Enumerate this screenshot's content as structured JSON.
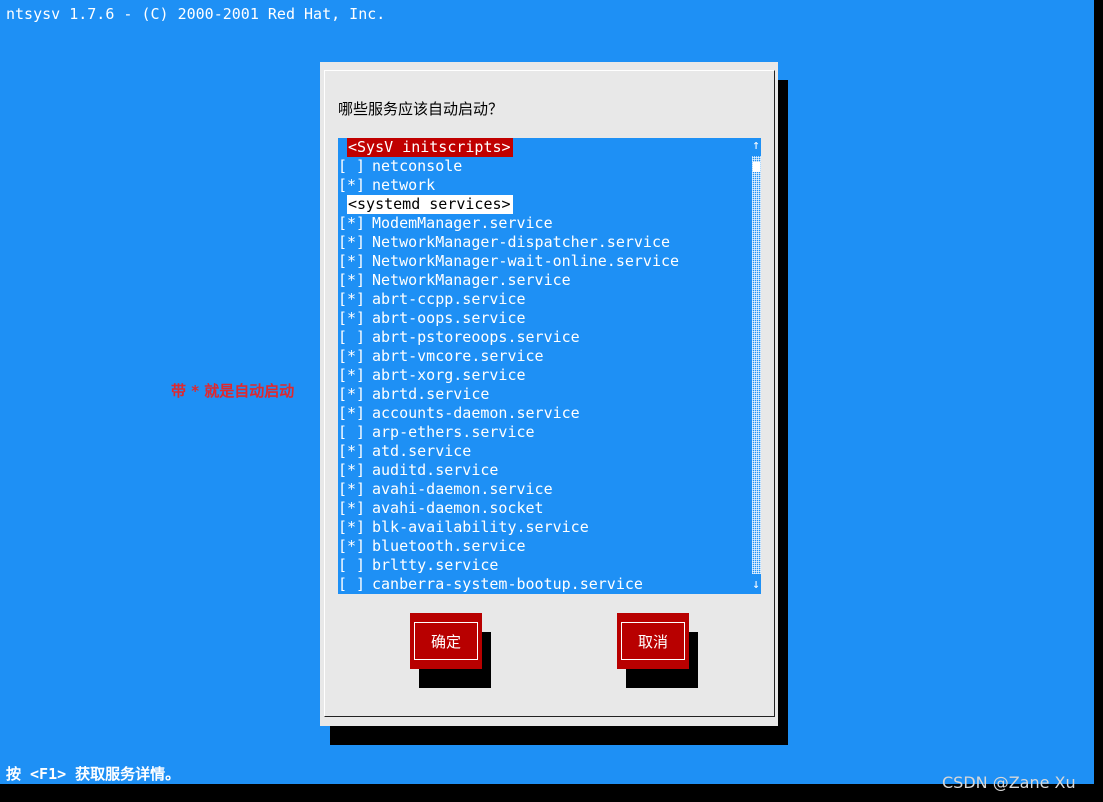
{
  "terminal": {
    "title": "ntsysv 1.7.6 - (C) 2000-2001 Red Hat, Inc.",
    "hint": "按 <F1> 获取服务详情。"
  },
  "annotation": "带 * 就是自动启动",
  "watermark": "CSDN @Zane Xu",
  "dialog": {
    "prompt": "哪些服务应该自动启动？",
    "items": [
      {
        "type": "header",
        "label": "<SysV initscripts>",
        "style": "selected"
      },
      {
        "type": "service",
        "mark": "[ ]",
        "name": "netconsole"
      },
      {
        "type": "service",
        "mark": "[*]",
        "name": "network"
      },
      {
        "type": "header",
        "label": "<systemd services>",
        "style": "normal"
      },
      {
        "type": "service",
        "mark": "[*]",
        "name": "ModemManager.service"
      },
      {
        "type": "service",
        "mark": "[*]",
        "name": "NetworkManager-dispatcher.service"
      },
      {
        "type": "service",
        "mark": "[*]",
        "name": "NetworkManager-wait-online.service"
      },
      {
        "type": "service",
        "mark": "[*]",
        "name": "NetworkManager.service"
      },
      {
        "type": "service",
        "mark": "[*]",
        "name": "abrt-ccpp.service"
      },
      {
        "type": "service",
        "mark": "[*]",
        "name": "abrt-oops.service"
      },
      {
        "type": "service",
        "mark": "[ ]",
        "name": "abrt-pstoreoops.service"
      },
      {
        "type": "service",
        "mark": "[*]",
        "name": "abrt-vmcore.service"
      },
      {
        "type": "service",
        "mark": "[*]",
        "name": "abrt-xorg.service"
      },
      {
        "type": "service",
        "mark": "[*]",
        "name": "abrtd.service"
      },
      {
        "type": "service",
        "mark": "[*]",
        "name": "accounts-daemon.service"
      },
      {
        "type": "service",
        "mark": "[ ]",
        "name": "arp-ethers.service"
      },
      {
        "type": "service",
        "mark": "[*]",
        "name": "atd.service"
      },
      {
        "type": "service",
        "mark": "[*]",
        "name": "auditd.service"
      },
      {
        "type": "service",
        "mark": "[*]",
        "name": "avahi-daemon.service"
      },
      {
        "type": "service",
        "mark": "[*]",
        "name": "avahi-daemon.socket"
      },
      {
        "type": "service",
        "mark": "[*]",
        "name": "blk-availability.service"
      },
      {
        "type": "service",
        "mark": "[*]",
        "name": "bluetooth.service"
      },
      {
        "type": "service",
        "mark": "[ ]",
        "name": "brltty.service"
      },
      {
        "type": "service",
        "mark": "[ ]",
        "name": "canberra-system-bootup.service"
      }
    ],
    "scrollbar": {
      "up_arrow": "↑",
      "down_arrow": "↓"
    },
    "ok_label": "确定",
    "cancel_label": "取消"
  },
  "colors": {
    "screen_bg": "#1e90f5",
    "dialog_bg": "#e8e8e8",
    "button_bg": "#b80000",
    "selected_bg": "#c00000",
    "annotation": "#e0282d"
  }
}
